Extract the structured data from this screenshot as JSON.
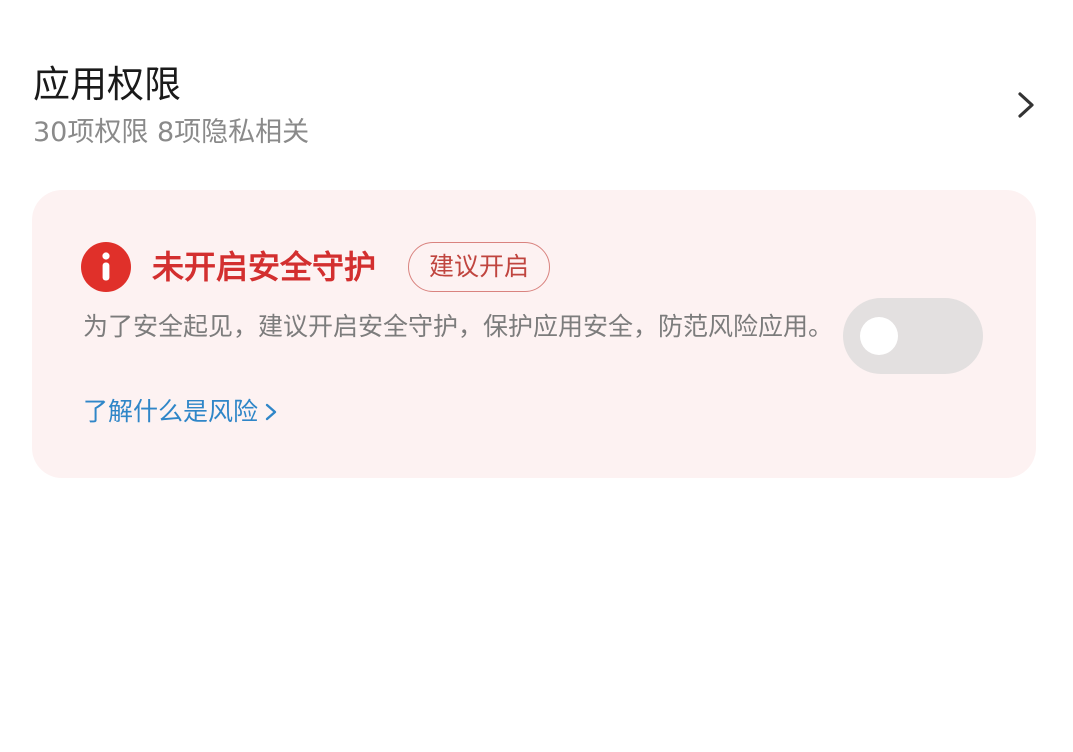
{
  "app_permissions": {
    "title": "应用权限",
    "summary": "30项权限 8项隐私相关",
    "chevron_icon": "chevron-right-icon"
  },
  "security_card": {
    "icon": "exclamation-circle-icon",
    "title": "未开启安全守护",
    "badge": "建议开启",
    "description": "为了安全起见，建议开启安全守护，保护应用安全，防范风险应用。",
    "link": "了解什么是风险",
    "link_icon": "chevron-right-icon",
    "toggle": {
      "state": "off"
    },
    "colors": {
      "card_background": "#fdf2f2",
      "warning": "#d32f2f",
      "link": "#2f86c8",
      "toggle_off": "#e3e0e0"
    }
  }
}
